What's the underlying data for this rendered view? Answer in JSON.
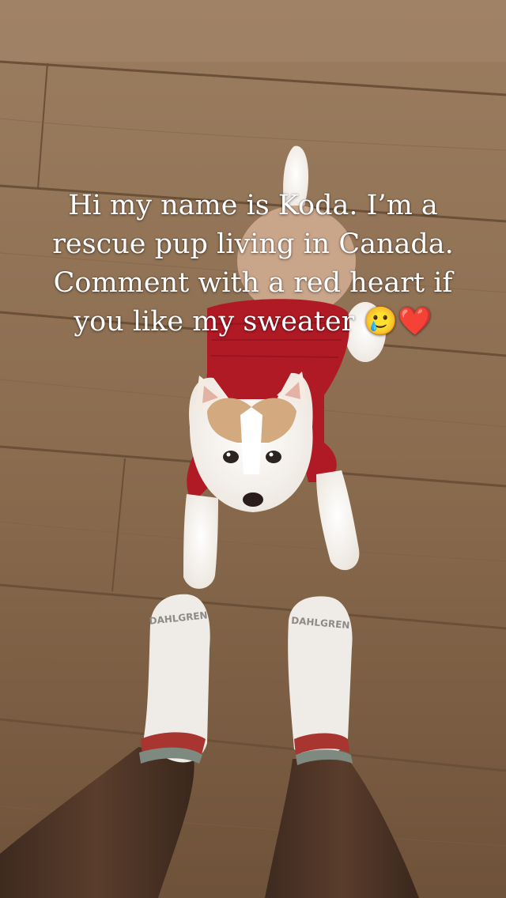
{
  "caption": {
    "lines": [
      "Hi my name is Koda. I’m a",
      "rescue pup living in Canada.",
      "Comment with a red heart if",
      "you like my sweater 🥲❤️"
    ]
  },
  "sock_brand": "DAHLGREN",
  "colors": {
    "floor": "#8a6c4e",
    "sweater": "#b01a25",
    "caption_text": "#ffffff"
  }
}
